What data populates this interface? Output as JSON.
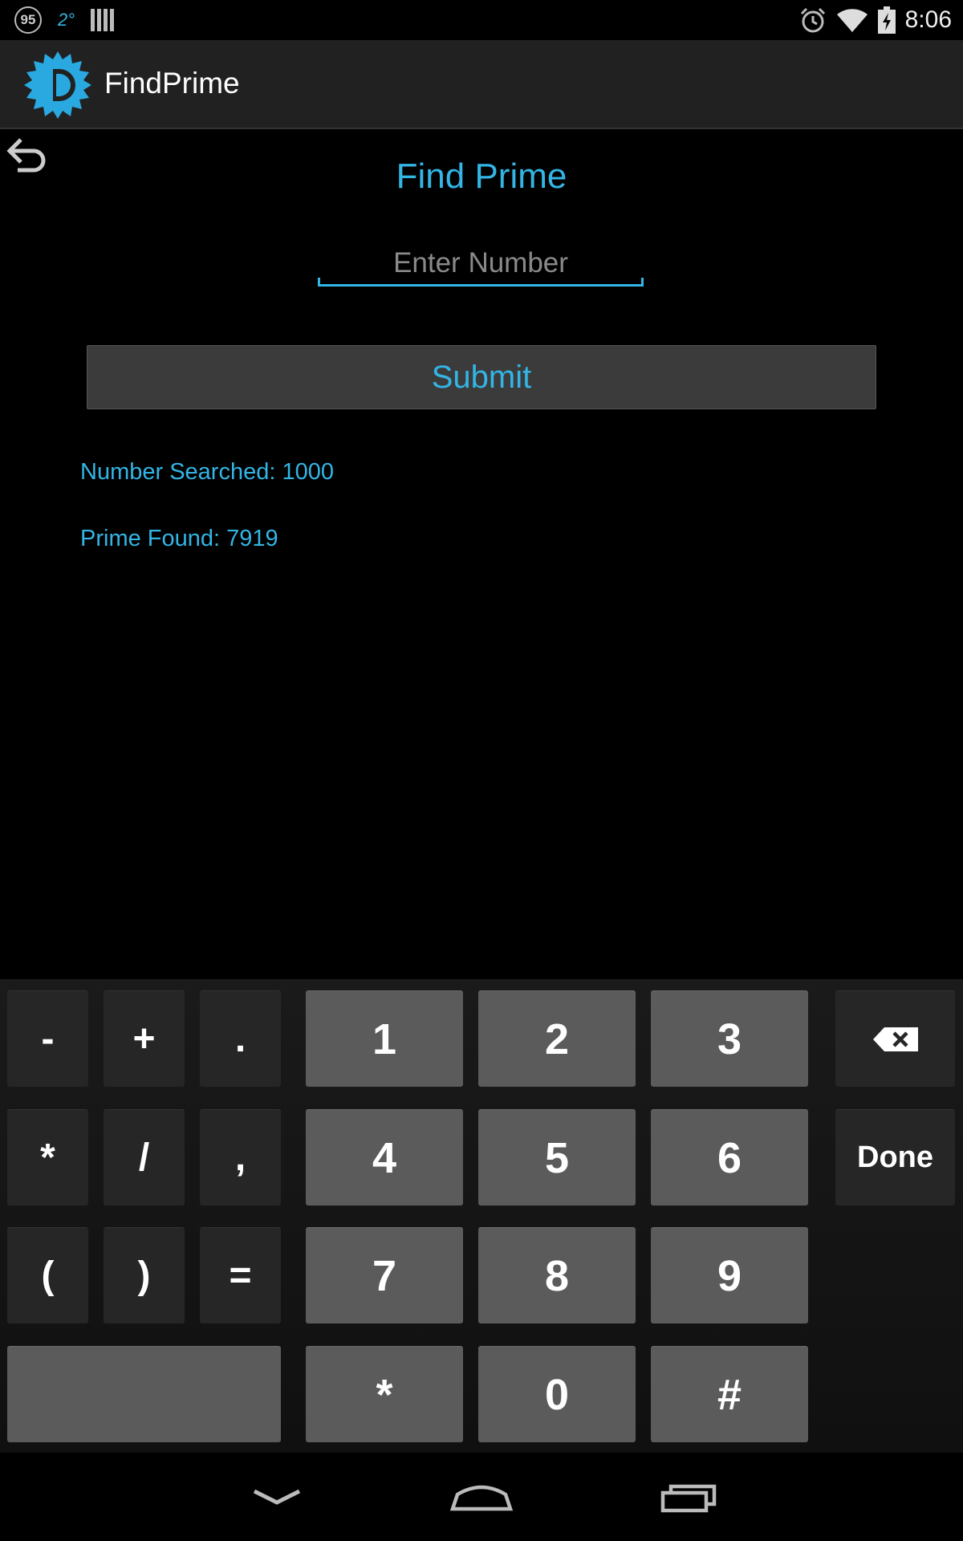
{
  "status_bar": {
    "notification_count": "95",
    "temperature": "2°",
    "time": "8:06"
  },
  "action_bar": {
    "app_title": "FindPrime"
  },
  "main": {
    "title": "Find Prime",
    "input_placeholder": "Enter Number",
    "input_value": "",
    "submit_label": "Submit",
    "number_searched_label": "Number Searched:",
    "number_searched_value": "1000",
    "prime_found_label": "Prime Found:",
    "prime_found_value": "7919"
  },
  "keyboard": {
    "rows": [
      [
        "-",
        "+",
        ".",
        "1",
        "2",
        "3",
        "backspace"
      ],
      [
        "*",
        "/",
        ",",
        "4",
        "5",
        "6",
        "Done"
      ],
      [
        "(",
        ")",
        "=",
        "7",
        "8",
        "9"
      ],
      [
        "space",
        "*",
        "0",
        "#"
      ]
    ],
    "done_label": "Done"
  },
  "nav_bar": {
    "icons": [
      "back-chevron-icon",
      "home-icon",
      "recents-icon"
    ]
  },
  "colors": {
    "accent": "#33b5e5",
    "background": "#000000",
    "action_bar": "#212121",
    "key_light": "#5b5b5b",
    "key_dark": "#262626"
  }
}
